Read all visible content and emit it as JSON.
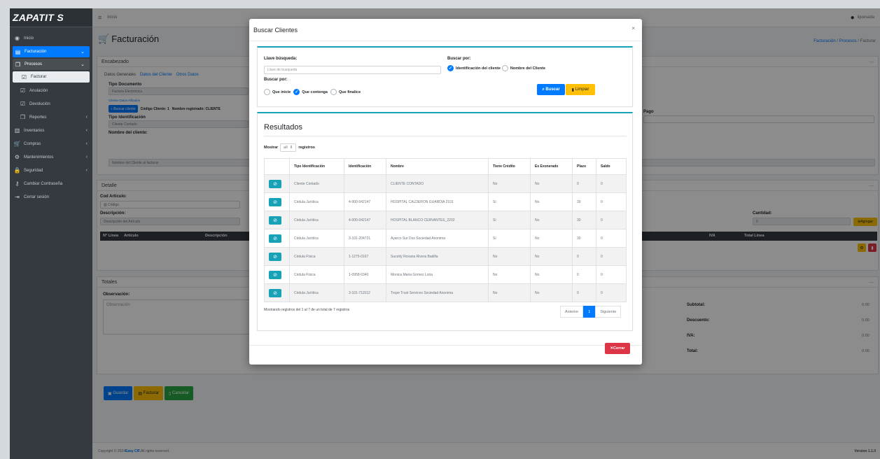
{
  "brand": "ZAPATIT S",
  "sidebar": {
    "items": [
      {
        "label": "Inicio",
        "icon": "gauge-icon"
      },
      {
        "label": "Facturación",
        "icon": "file-icon"
      },
      {
        "label": "Procesos",
        "icon": "copy-icon"
      },
      {
        "label": "Facturar",
        "icon": "checkbox-icon"
      },
      {
        "label": "Anulación",
        "icon": "checkbox-icon"
      },
      {
        "label": "Devolución",
        "icon": "checkbox-icon"
      },
      {
        "label": "Reportes",
        "icon": "copy-icon"
      },
      {
        "label": "Inventarios",
        "icon": "barcode-icon"
      },
      {
        "label": "Compras",
        "icon": "cart-icon"
      },
      {
        "label": "Mantenimientos",
        "icon": "cogs-icon"
      },
      {
        "label": "Seguridad",
        "icon": "lock-icon"
      },
      {
        "label": "Cambiar Contraseña",
        "icon": "key-icon"
      },
      {
        "label": "Cerrar sesión",
        "icon": "signout-icon"
      }
    ]
  },
  "topnav": {
    "home": "Inicio",
    "user": "lquesada"
  },
  "page": {
    "title": "Facturación",
    "breadcrumb": [
      "Facturación",
      "Procesos",
      "Facturar"
    ]
  },
  "encabezado": {
    "title": "Encabezado",
    "tabs": [
      "Datos Generales",
      "Datos del Cliente",
      "Otros Datos"
    ],
    "tipo_documento_label": "Tipo Documento",
    "tipo_documento_value": "Factura Electrónica",
    "link_small": "Cliente Datos Afiliados",
    "buscar_cliente": "Buscar cliente",
    "codigo_cliente": "Código Cliente: 1",
    "nombre_registrado": "Nombre registrado: CLIENTE",
    "tipo_identificacion_label": "Tipo Identificación",
    "tipo_identificacion_value": "Cliente Contado",
    "nombre_cliente_label": "Nombre del cliente:",
    "nombre_cliente_placeholder": "Nombre del Cliente al facturar",
    "pago_label": "Pago"
  },
  "detalle": {
    "title": "Detalle",
    "cod_articulo": "Cod Artículo:",
    "codigo_placeholder": "Código",
    "descripcion": "Descripción:",
    "descripcion_placeholder": "Descripción del Artículo",
    "cantidad": "Cantidad:",
    "cantidad_value": "0",
    "agregar": "Agregar",
    "cols": [
      "N° Línea",
      "Artículo",
      "Descripción",
      "IVA",
      "Total Línea"
    ]
  },
  "totales": {
    "title": "Totales",
    "observacion": "Observación:",
    "observacion_placeholder": "Observación",
    "rows": [
      {
        "label": "Subtotal:",
        "value": "0.00"
      },
      {
        "label": "Descuento:",
        "value": "0.00"
      },
      {
        "label": "IVA:",
        "value": "0.00"
      },
      {
        "label": "Total:",
        "value": "0.00"
      }
    ]
  },
  "actions": {
    "guardar": "Guardar",
    "facturar": "Facturar",
    "cancelar": "Cancelar"
  },
  "footer": {
    "copy": "Copyright © 2024 ",
    "brand": "Easy CIF.",
    "rights": " All rights reserved.",
    "version": "Version 1.1.0"
  },
  "modal": {
    "title": "Buscar Clientes",
    "llave_label": "Llave búsqueda:",
    "llave_placeholder": "Llave de busqueda",
    "buscar_por_label": "Buscar por:",
    "buscar_por_opts": [
      "Identificación del cliente",
      "Nombre del Cliente"
    ],
    "buscar_por2_label": "Buscar por:",
    "match_opts": [
      "Que inicie",
      "Que contenga",
      "Que finalice"
    ],
    "buscar_btn": "Buscar",
    "limpiar_btn": "Limpiar",
    "resultados": "Resultados",
    "mostrar": "Mostrar",
    "mostrar_value": "all",
    "registros": "registros",
    "columns": [
      "",
      "Tipo Identificación",
      "Identificación",
      "Nombre",
      "Tiene Crédito",
      "Es Exonerado",
      "Plazo",
      "Saldo"
    ],
    "rows": [
      [
        "Cliente Contado",
        "",
        "CLIENTE CONTADO",
        "No",
        "No",
        "0",
        "0"
      ],
      [
        "Cédula Jurídica",
        "4-000-042147",
        "HOSPITAL CALDERON GUARDIA 2101",
        "Sí",
        "No",
        "30",
        "0"
      ],
      [
        "Cédula Jurídica",
        "4-000-042147",
        "HOSPITAL BLANCO CERVANTES_2202",
        "Sí",
        "No",
        "30",
        "0"
      ],
      [
        "Cédula Jurídica",
        "3-101-204721",
        "Ayarco Sur Dos Sociedad Anonima",
        "Sí",
        "No",
        "30",
        "0"
      ],
      [
        "Cédula Física",
        "1-1275-0167",
        "Sucetty Roxana Rivera Badilla",
        "No",
        "No",
        "0",
        "0"
      ],
      [
        "Cédula Física",
        "1-0958-0340",
        "Monica Maria Gomez Loria",
        "No",
        "No",
        "0",
        "0"
      ],
      [
        "Cédula Jurídica",
        "3-101-711512",
        "Trope Trust Services Sociedad Anonima",
        "No",
        "No",
        "0",
        "0"
      ]
    ],
    "info": "Mostrando registros del 1 al 7 de un total de 7 registros",
    "pagination": {
      "prev": "Anterior",
      "page": "1",
      "next": "Siguiente"
    },
    "cerrar": "Cerrar"
  }
}
